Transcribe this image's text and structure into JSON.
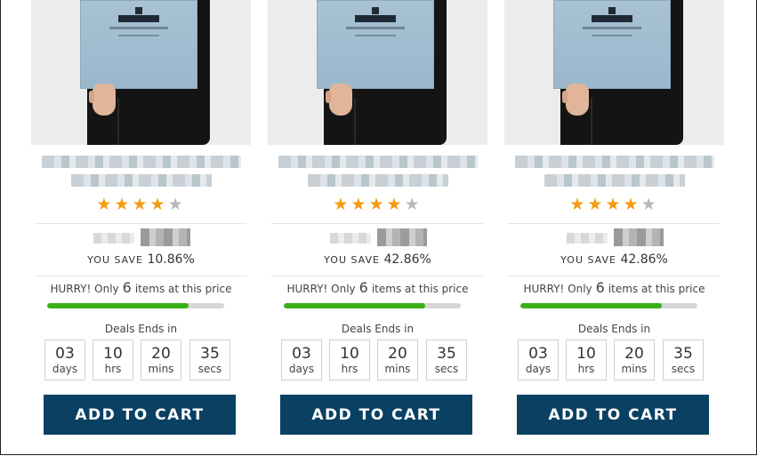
{
  "products": [
    {
      "rating": 4,
      "max_rating": 5,
      "you_save_label": "YOU SAVE",
      "you_save_value": "10.86%",
      "hurry_prefix": "HURRY! Only",
      "hurry_count": "6",
      "hurry_suffix": "items at this price",
      "stock_fraction": 0.8,
      "deals_label": "Deals Ends in",
      "timer": [
        {
          "value": "03",
          "unit": "days"
        },
        {
          "value": "10",
          "unit": "hrs"
        },
        {
          "value": "20",
          "unit": "mins"
        },
        {
          "value": "35",
          "unit": "secs"
        }
      ],
      "cart_label": "ADD TO CART"
    },
    {
      "rating": 4,
      "max_rating": 5,
      "you_save_label": "YOU SAVE",
      "you_save_value": "42.86%",
      "hurry_prefix": "HURRY! Only",
      "hurry_count": "6",
      "hurry_suffix": "items at this price",
      "stock_fraction": 0.8,
      "deals_label": "Deals Ends in",
      "timer": [
        {
          "value": "03",
          "unit": "days"
        },
        {
          "value": "10",
          "unit": "hrs"
        },
        {
          "value": "20",
          "unit": "mins"
        },
        {
          "value": "35",
          "unit": "secs"
        }
      ],
      "cart_label": "ADD TO CART"
    },
    {
      "rating": 4,
      "max_rating": 5,
      "you_save_label": "YOU SAVE",
      "you_save_value": "42.86%",
      "hurry_prefix": "HURRY! Only",
      "hurry_count": "6",
      "hurry_suffix": "items at this price",
      "stock_fraction": 0.8,
      "deals_label": "Deals Ends in",
      "timer": [
        {
          "value": "03",
          "unit": "days"
        },
        {
          "value": "10",
          "unit": "hrs"
        },
        {
          "value": "20",
          "unit": "mins"
        },
        {
          "value": "35",
          "unit": "secs"
        }
      ],
      "cart_label": "ADD TO CART"
    }
  ],
  "colors": {
    "star_on": "#f39c12",
    "star_off": "#b8b8b8",
    "progress": "#3ab016",
    "cart_button": "#0a4163"
  },
  "icons": [
    "star-icon"
  ]
}
